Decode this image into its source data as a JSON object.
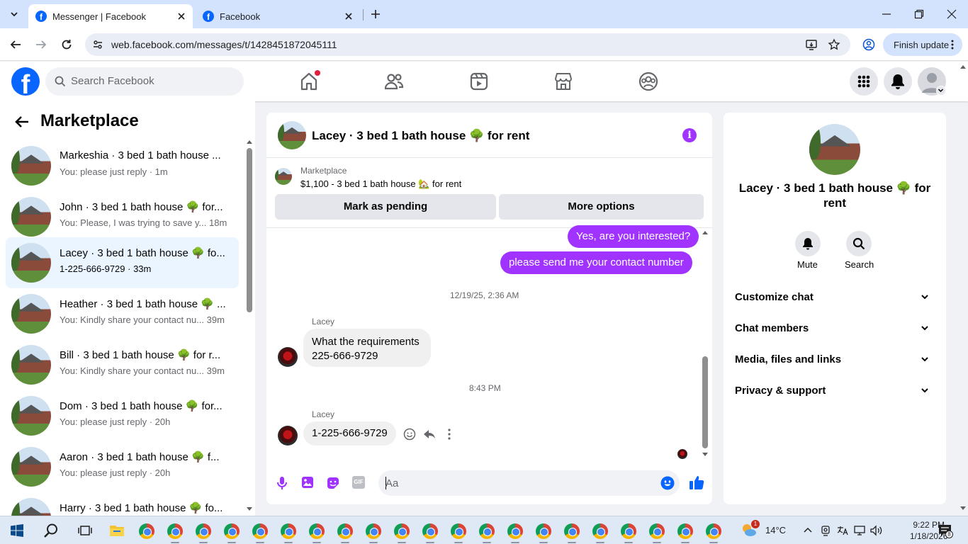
{
  "browser": {
    "tabs": [
      {
        "title": "Messenger | Facebook",
        "active": true
      },
      {
        "title": "Facebook",
        "active": false
      }
    ],
    "url": "web.facebook.com/messages/t/1428451872045111",
    "finish_update_label": "Finish update"
  },
  "fb_header": {
    "logo": "f",
    "search_placeholder": "Search Facebook",
    "nav_icons": [
      "home-icon",
      "friends-icon",
      "video-icon",
      "marketplace-icon",
      "groups-icon"
    ],
    "right_icons": [
      "menu-grid-icon",
      "notifications-bell-icon",
      "account-avatar"
    ]
  },
  "sidebar": {
    "title": "Marketplace",
    "conversations": [
      {
        "name": "Markeshia · 3 bed 1 bath house ...",
        "preview": "You: please just reply · 1m",
        "selected": false
      },
      {
        "name": "John · 3 bed 1 bath house 🌳 for...",
        "preview": "You: Please, I was trying to save y...  18m",
        "selected": false
      },
      {
        "name": "Lacey · 3 bed 1 bath house 🌳 fo...",
        "preview": "1-225-666-9729 · 33m",
        "selected": true
      },
      {
        "name": "Heather · 3 bed 1 bath house 🌳 ...",
        "preview": "You: Kindly share your contact nu...  39m",
        "selected": false
      },
      {
        "name": "Bill · 3 bed 1 bath house 🌳 for r...",
        "preview": "You: Kindly share your contact nu...  39m",
        "selected": false
      },
      {
        "name": "Dom · 3 bed 1 bath house 🌳 for...",
        "preview": "You: please just reply · 20h",
        "selected": false
      },
      {
        "name": "Aaron · 3 bed 1 bath house 🌳 f...",
        "preview": "You: please just reply · 20h",
        "selected": false
      },
      {
        "name": "Harry · 3 bed 1 bath house 🌳 fo...",
        "preview": "",
        "selected": false
      }
    ]
  },
  "chat": {
    "title": "Lacey · 3 bed 1 bath house 🌳 for rent",
    "listing": {
      "label": "Marketplace",
      "details": "$1,100 - 3 bed 1 bath house 🏡 for rent",
      "mark_pending": "Mark as pending",
      "more_options": "More options"
    },
    "messages": {
      "out_1": "Yes, are you interested?",
      "out_2": "please send me  your contact number",
      "stamp_1": "12/19/25, 2:36 AM",
      "sender_1": "Lacey",
      "in_1_line1": "What the requirements",
      "in_1_line2": "225-666-9729",
      "stamp_2": "8:43 PM",
      "sender_2": "Lacey",
      "in_2": "1-225-666-9729"
    },
    "composer_placeholder": "Aa"
  },
  "details_panel": {
    "name": "Lacey · 3 bed 1 bath house 🌳 for rent",
    "mute_label": "Mute",
    "search_label": "Search",
    "sections": [
      "Customize chat",
      "Chat members",
      "Media, files and links",
      "Privacy & support"
    ]
  },
  "taskbar": {
    "weather_temp": "14°C",
    "weather_badge": "1",
    "time": "9:22 PM",
    "date": "1/18/2026",
    "notification_count": "8"
  },
  "colors": {
    "accent_purple": "#a033ff",
    "fb_blue": "#0866ff",
    "selected_row": "#ebf5ff"
  }
}
